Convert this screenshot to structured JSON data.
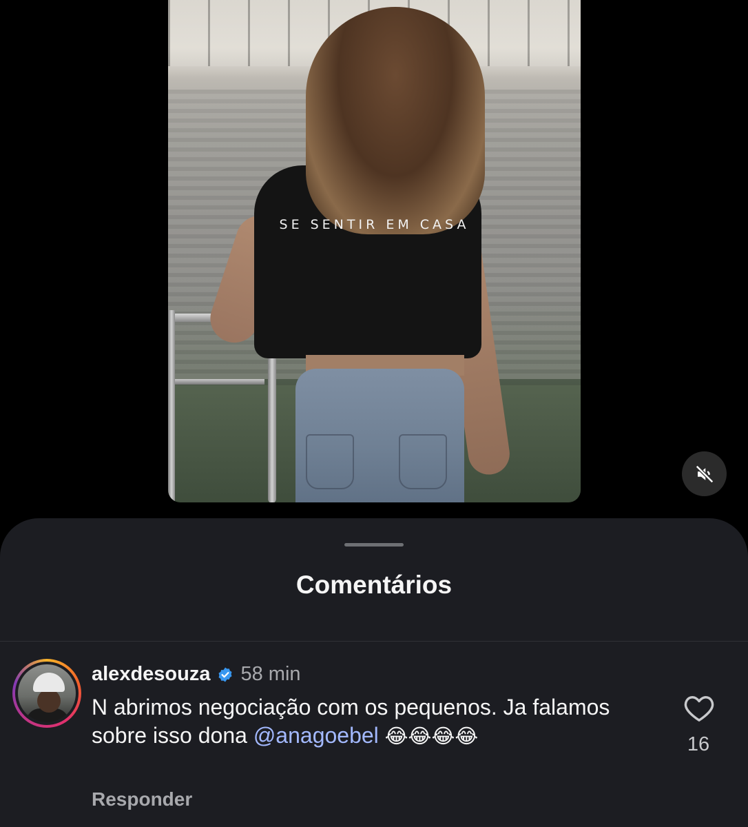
{
  "video": {
    "overlay_caption": "SE SENTIR EM CASA",
    "mute_icon": "speaker-muted-icon"
  },
  "comments_sheet": {
    "title": "Comentários",
    "comment": {
      "username": "alexdesouza",
      "verified_icon": "verified-badge-icon",
      "time": "58 min",
      "text_part1": "N abrimos negociação com os pequenos. Ja falamos sobre isso dona ",
      "mention": "@anagoebel",
      "emojis": "😂😂😂😂",
      "reply_label": "Responder",
      "like_icon": "heart-outline-icon",
      "like_count": "16"
    }
  },
  "colors": {
    "background": "#000000",
    "sheet": "#1c1d22",
    "mention": "#a3b9ff",
    "muted_text": "#a8a9ad",
    "verified": "#3897f0"
  }
}
